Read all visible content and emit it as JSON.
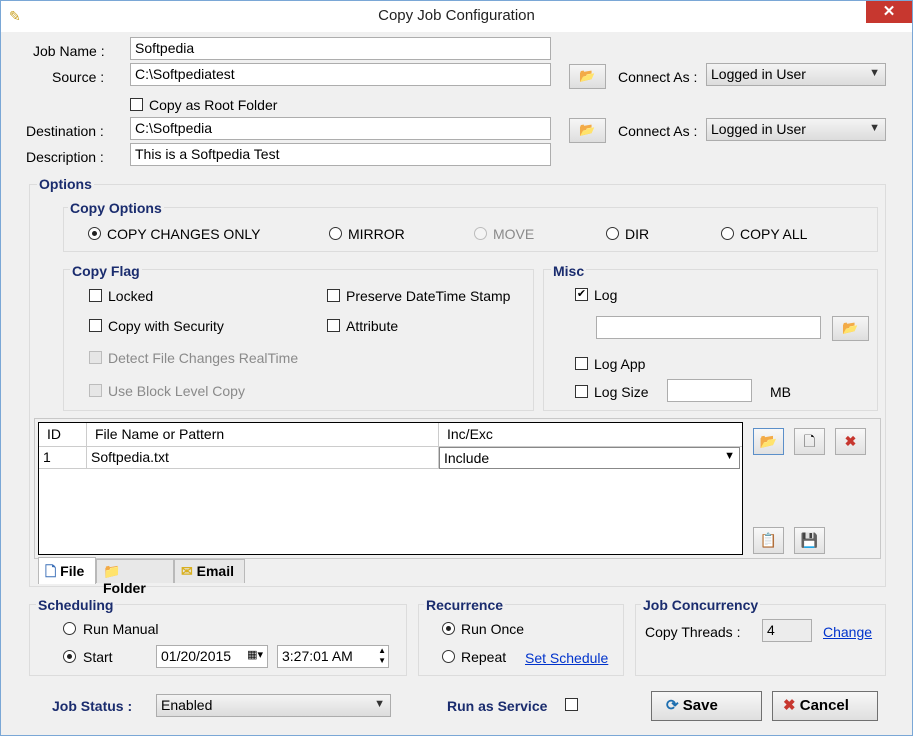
{
  "window": {
    "title": "Copy Job Configuration",
    "close": "✕"
  },
  "job": {
    "name_label": "Job Name :",
    "name_value": "Softpedia",
    "source_label": "Source :",
    "source_value": "C:\\Softpediatest",
    "copy_root_label": "Copy as Root Folder",
    "dest_label": "Destination :",
    "dest_value": "C:\\Softpedia",
    "desc_label": "Description :",
    "desc_value": "This is a Softpedia Test",
    "connect_as_label": "Connect As :",
    "connect_as_source": "Logged in User",
    "connect_as_dest": "Logged in User"
  },
  "options": {
    "title": "Options",
    "copy_options": {
      "title": "Copy Options",
      "radios": [
        "COPY CHANGES ONLY",
        "MIRROR",
        "MOVE",
        "DIR",
        "COPY ALL"
      ]
    },
    "copy_flag": {
      "title": "Copy Flag",
      "locked": "Locked",
      "copy_security": "Copy with Security",
      "detect_changes": "Detect File Changes RealTime",
      "block_level": "Use Block Level Copy",
      "preserve_stamp": "Preserve DateTime Stamp",
      "attribute": "Attribute"
    },
    "misc": {
      "title": "Misc",
      "log": "Log",
      "log_path": "",
      "log_app": "Log App",
      "log_size": "Log Size",
      "log_size_value": "",
      "mb": "MB"
    }
  },
  "grid": {
    "headers": [
      "ID",
      "File Name or Pattern",
      "Inc/Exc"
    ],
    "rows": [
      {
        "id": "1",
        "pattern": "Softpedia.txt",
        "incexc": "Include"
      }
    ]
  },
  "tabs": [
    "File",
    "Folder",
    "Email"
  ],
  "scheduling": {
    "title": "Scheduling",
    "run_manual": "Run Manual",
    "start": "Start",
    "date": "01/20/2015",
    "time": "3:27:01 AM"
  },
  "recurrence": {
    "title": "Recurrence",
    "run_once": "Run Once",
    "repeat": "Repeat",
    "set_schedule": "Set Schedule"
  },
  "concurrency": {
    "title": "Job Concurrency",
    "threads_label": "Copy Threads :",
    "threads_value": "4",
    "change": "Change"
  },
  "footer": {
    "status_label": "Job Status :",
    "status_value": "Enabled",
    "run_service": "Run as Service",
    "save": "Save",
    "cancel": "Cancel"
  }
}
